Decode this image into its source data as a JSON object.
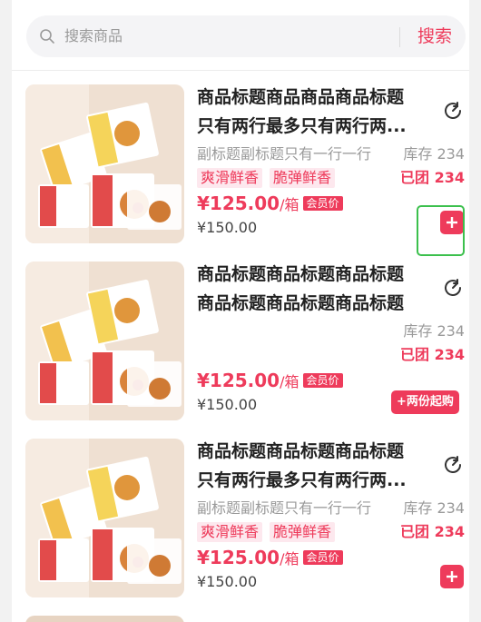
{
  "search": {
    "placeholder": "搜索商品",
    "button": "搜索"
  },
  "products": [
    {
      "title_line1": "商品标题商品商品商品标题",
      "title_line2": "只有两行最多只有两行两...",
      "subtitle": "副标题副标题只有一行一行",
      "stock": "库存 234",
      "tags": [
        "爽滑鲜香",
        "脆弹鲜香"
      ],
      "grouped": "已团 234",
      "price": "¥125.00",
      "unit": "/箱",
      "member_badge": "会员价",
      "original_price": "¥150.00",
      "action": "add"
    },
    {
      "title_line1": "商品标题商品标题商品标题",
      "title_line2": "商品标题商品标题商品标题",
      "subtitle": "",
      "stock": "库存 234",
      "tags": [],
      "grouped": "已团 234",
      "price": "¥125.00",
      "unit": "/箱",
      "member_badge": "会员价",
      "original_price": "¥150.00",
      "action": "+两份起购"
    },
    {
      "title_line1": "商品标题商品标题商品标题",
      "title_line2": "只有两行最多只有两行两...",
      "subtitle": "副标题副标题只有一行一行",
      "stock": "库存 234",
      "tags": [
        "爽滑鲜香",
        "脆弹鲜香"
      ],
      "grouped": "已团 234",
      "price": "¥125.00",
      "unit": "/箱",
      "member_badge": "会员价",
      "original_price": "¥150.00",
      "action": "add"
    }
  ],
  "colors": {
    "accent": "#ee3b5b",
    "tag_bg": "#fde8ee",
    "highlight": "#3cc04d"
  },
  "icons": {
    "search": "search-icon",
    "refresh": "refresh-icon",
    "add": "plus-icon"
  }
}
